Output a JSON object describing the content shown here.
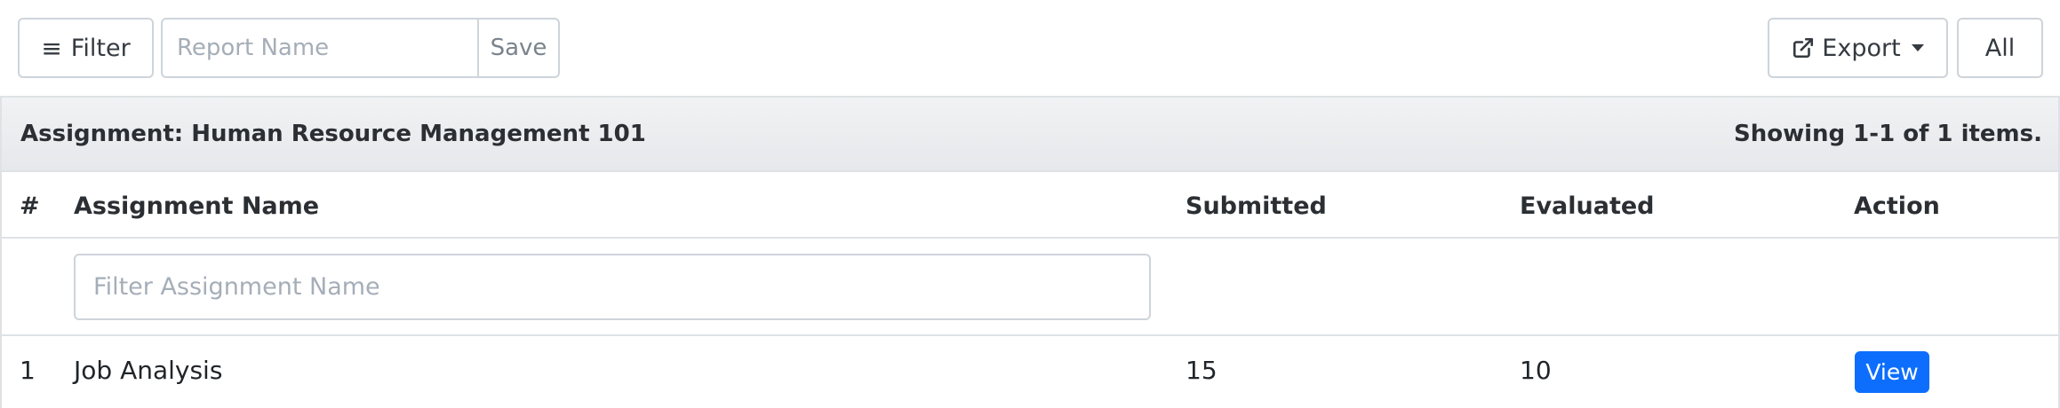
{
  "toolbar": {
    "filter_label": "Filter",
    "filter_icon": "≡",
    "report_name_placeholder": "Report Name",
    "report_name_value": "",
    "save_label": "Save",
    "export_label": "Export",
    "all_label": "All"
  },
  "panel": {
    "title": "Assignment: Human Resource Management 101",
    "summary": "Showing 1-1 of 1 items."
  },
  "table": {
    "columns": [
      "#",
      "Assignment Name",
      "Submitted",
      "Evaluated",
      "Action"
    ],
    "filter_placeholder": "Filter Assignment Name",
    "rows": [
      {
        "num": "1",
        "name": "Job Analysis",
        "submitted": "15",
        "evaluated": "10",
        "action": "View"
      }
    ]
  },
  "colors": {
    "primary": "#0d6efd",
    "border": "#ced4da",
    "header_bg": "#e9ecef"
  }
}
